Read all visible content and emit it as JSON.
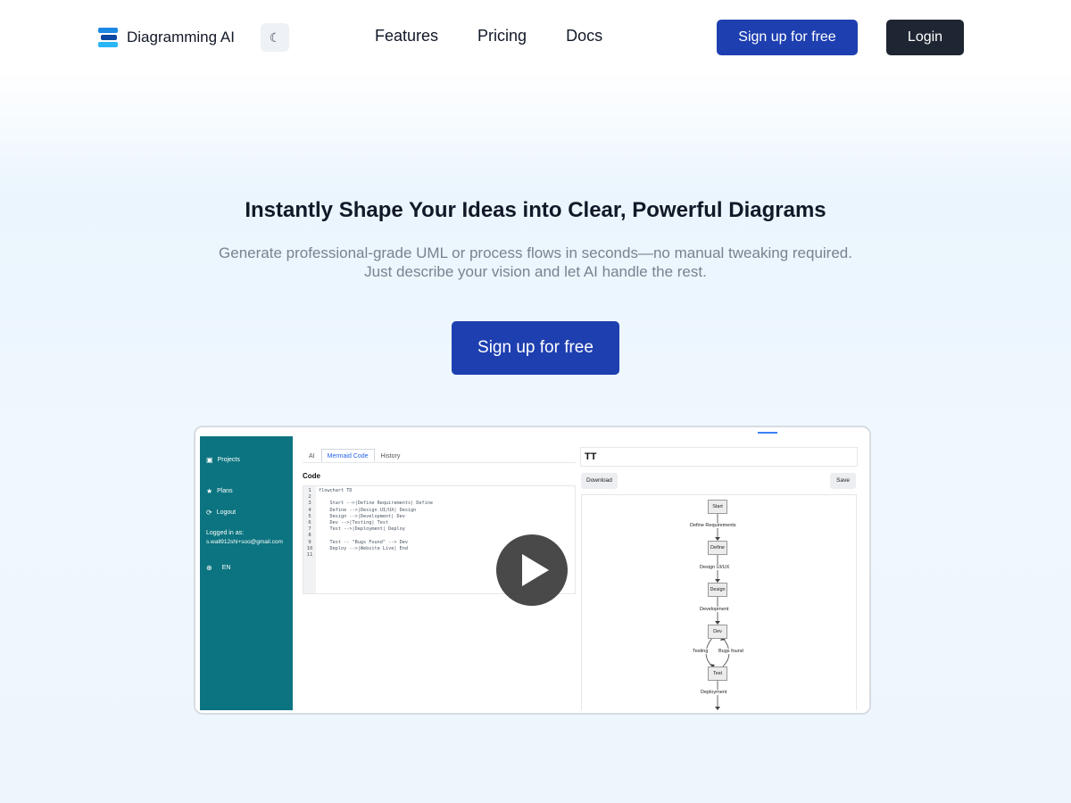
{
  "nav": {
    "brand": "Diagramming AI",
    "theme_icon": "moon-icon",
    "links": [
      "Features",
      "Pricing",
      "Docs"
    ],
    "signup_label": "Sign up for free",
    "login_label": "Login"
  },
  "hero": {
    "title": "Instantly Shape Your Ideas into Clear, Powerful Diagrams",
    "subtitle_line1": "Generate professional-grade UML or process flows in seconds—no manual tweaking required.",
    "subtitle_line2": "Just describe your vision and let AI handle the rest.",
    "cta_label": "Sign up for free"
  },
  "preview": {
    "sidebar": {
      "projects": "Projects",
      "plans": "Plans",
      "logout": "Logout",
      "logged_in_label": "Logged in as:",
      "email": "s.wall912shi+soo@gmail.com",
      "language": "EN"
    },
    "tabs": [
      "AI",
      "Mermaid Code",
      "History"
    ],
    "code_label": "Code",
    "line_numbers": [
      "1",
      "2",
      "3",
      "4",
      "5",
      "6",
      "7",
      "8",
      "9",
      "10",
      "11"
    ],
    "code_lines": [
      "flowchart TD",
      "",
      "    Start -->|Define Requirements| Define",
      "    Define -->|Design UI/UX| Design",
      "    Design -->|Development| Dev",
      "    Dev -->|Testing| Test",
      "    Test -->|Deployment| Deploy",
      "",
      "    Test -- \"Bugs Found\" --> Dev",
      "    Deploy -->|Website Live| End",
      ""
    ],
    "diagram_title": "TT",
    "download_label": "Download",
    "save_label": "Save",
    "nodes": {
      "start": "Start",
      "define": "Define",
      "design": "Design",
      "dev": "Dev",
      "test": "Test"
    },
    "edges": {
      "define_requirements": "Define Requirements",
      "design_ui": "Design UI/UX",
      "development": "Development",
      "testing": "Testing",
      "bugs_found": "Bugs found",
      "deployment": "Deployment"
    }
  },
  "colors": {
    "primary": "#1e3fb0",
    "dark": "#1f2633",
    "sidebar": "#0b7480"
  }
}
